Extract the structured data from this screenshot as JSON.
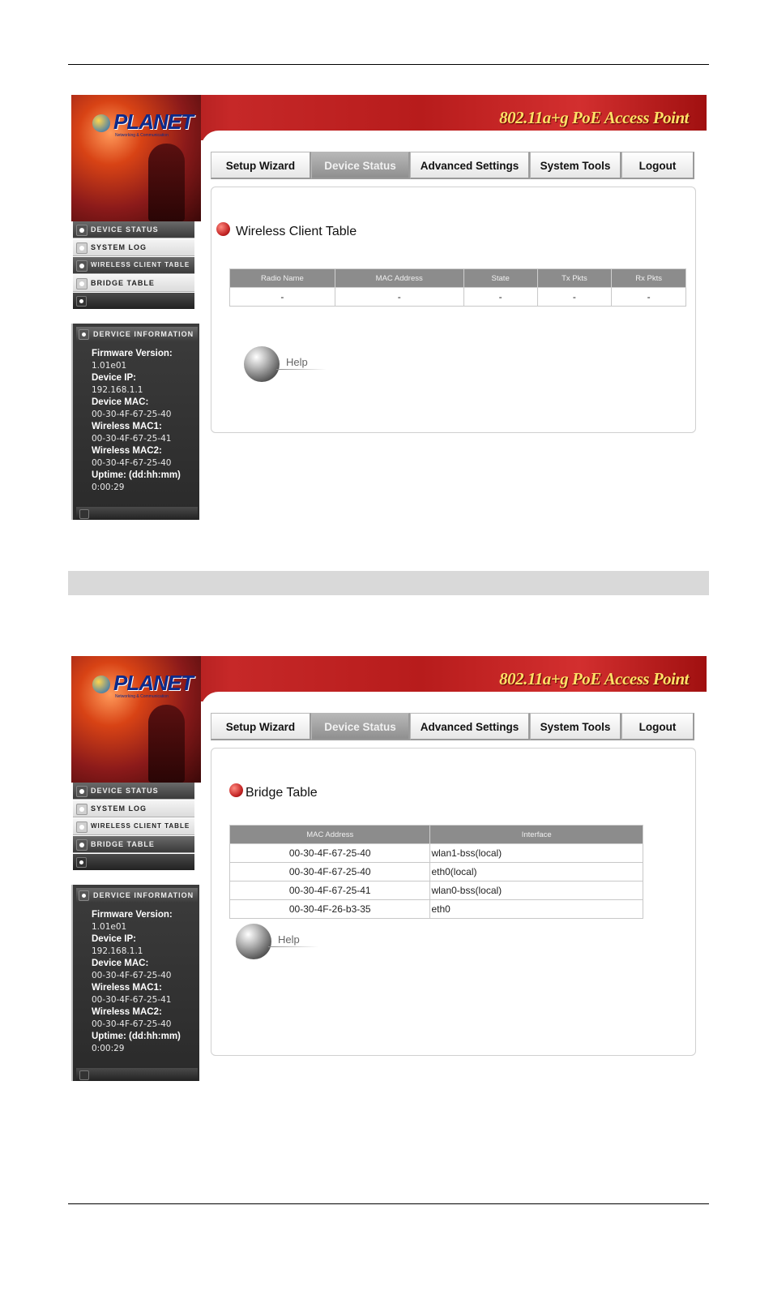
{
  "screenshot1": {
    "banner_title": "802.11a+g PoE Access Point",
    "logo": {
      "name": "PLANET",
      "tagline": "Networking & Communication"
    },
    "menu": [
      {
        "label": "Device Status",
        "active": true
      },
      {
        "label": "System Log",
        "active": false
      },
      {
        "label": "Wireless Client Table",
        "active": true
      },
      {
        "label": "Bridge Table",
        "active": false
      }
    ],
    "device_info": {
      "header": "Dervice Information",
      "items": [
        {
          "key": "Firmware Version:",
          "value": "1.01e01"
        },
        {
          "key": "Device IP:",
          "value": "192.168.1.1"
        },
        {
          "key": "Device MAC:",
          "value": "00-30-4F-67-25-40"
        },
        {
          "key": "Wireless MAC1:",
          "value": "00-30-4F-67-25-41"
        },
        {
          "key": "Wireless MAC2:",
          "value": "00-30-4F-67-25-40"
        },
        {
          "key": "Uptime: (dd:hh:mm)",
          "value": "0:00:29"
        }
      ]
    },
    "tabs": [
      "Setup Wizard",
      "Device Status",
      "Advanced Settings",
      "System Tools",
      "Logout"
    ],
    "active_tab": "Device Status",
    "panel_title": "Wireless Client Table",
    "table": {
      "headers": [
        "Radio Name",
        "MAC Address",
        "State",
        "Tx Pkts",
        "Rx Pkts"
      ],
      "rows": [
        [
          "-",
          "-",
          "-",
          "-",
          "-"
        ]
      ]
    },
    "help_label": "Help"
  },
  "screenshot2": {
    "banner_title": "802.11a+g PoE Access Point",
    "logo": {
      "name": "PLANET",
      "tagline": "Networking & Communication"
    },
    "menu": [
      {
        "label": "Device Status",
        "active": true
      },
      {
        "label": "System Log",
        "active": false
      },
      {
        "label": "Wireless Client Table",
        "active": false
      },
      {
        "label": "Bridge Table",
        "active": true
      }
    ],
    "device_info": {
      "header": "Dervice Information",
      "items": [
        {
          "key": "Firmware Version:",
          "value": "1.01e01"
        },
        {
          "key": "Device IP:",
          "value": "192.168.1.1"
        },
        {
          "key": "Device MAC:",
          "value": "00-30-4F-67-25-40"
        },
        {
          "key": "Wireless MAC1:",
          "value": "00-30-4F-67-25-41"
        },
        {
          "key": "Wireless MAC2:",
          "value": "00-30-4F-67-25-40"
        },
        {
          "key": "Uptime: (dd:hh:mm)",
          "value": "0:00:29"
        }
      ]
    },
    "tabs": [
      "Setup Wizard",
      "Device Status",
      "Advanced Settings",
      "System Tools",
      "Logout"
    ],
    "active_tab": "Device Status",
    "panel_title": "Bridge Table",
    "table": {
      "headers": [
        "MAC Address",
        "Interface"
      ],
      "rows": [
        [
          "00-30-4F-67-25-40",
          "wlan1-bss(local)"
        ],
        [
          "00-30-4F-67-25-40",
          "eth0(local)"
        ],
        [
          "00-30-4F-67-25-41",
          "wlan0-bss(local)"
        ],
        [
          "00-30-4F-26-b3-35",
          "eth0"
        ]
      ]
    },
    "help_label": "Help"
  },
  "colors": {
    "banner_red": "#c62828",
    "banner_text": "#ffe066",
    "table_header": "#8c8c8c",
    "section_bar": "#d9d9d9"
  }
}
